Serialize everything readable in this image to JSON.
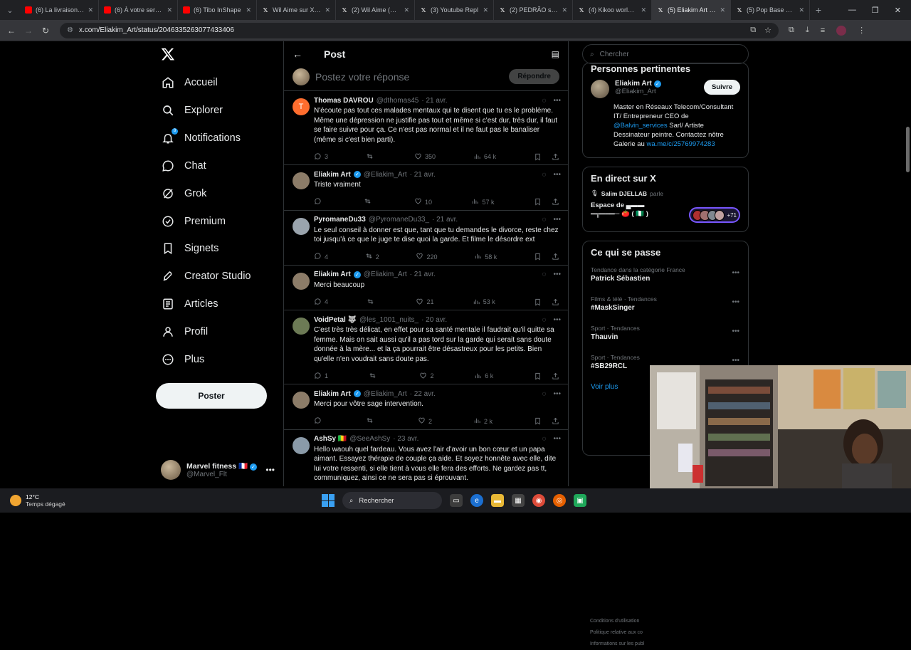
{
  "browser": {
    "tabs": [
      {
        "title": "(6) La livraison à d",
        "icon": "youtube-icon"
      },
      {
        "title": "(6) À votre service",
        "icon": "youtube-icon"
      },
      {
        "title": "(6) Tibo InShape",
        "icon": "youtube-icon"
      },
      {
        "title": "Wil Aime sur X : \"",
        "icon": "x-icon"
      },
      {
        "title": "(2) Wil Aime (@W",
        "icon": "x-icon"
      },
      {
        "title": "(3) Youtube Repl",
        "icon": "x-icon"
      },
      {
        "title": "(2) PEDRÃO sur X",
        "icon": "x-icon"
      },
      {
        "title": "(4) Kikoo world su",
        "icon": "x-icon"
      },
      {
        "title": "(5) Eliakim Art sur",
        "icon": "x-icon",
        "active": true
      },
      {
        "title": "(5) Pop Base sur X",
        "icon": "x-icon"
      }
    ],
    "url": "x.com/Eliakim_Art/status/2046335263077433406"
  },
  "nav": {
    "items": [
      {
        "label": "Accueil",
        "icon": "home-icon"
      },
      {
        "label": "Explorer",
        "icon": "search-icon"
      },
      {
        "label": "Notifications",
        "icon": "bell-icon"
      },
      {
        "label": "Chat",
        "icon": "chat-icon"
      },
      {
        "label": "Grok",
        "icon": "grok-icon"
      },
      {
        "label": "Premium",
        "icon": "premium-icon"
      },
      {
        "label": "Signets",
        "icon": "bookmark-icon"
      },
      {
        "label": "Creator Studio",
        "icon": "rocket-icon"
      },
      {
        "label": "Articles",
        "icon": "article-icon"
      },
      {
        "label": "Profil",
        "icon": "user-icon"
      },
      {
        "label": "Plus",
        "icon": "more-icon"
      }
    ],
    "post_label": "Poster",
    "account": {
      "name": "Marvel fitness 🇫🇷",
      "handle": "@Marvel_Flt"
    }
  },
  "main": {
    "title": "Post",
    "reply_placeholder": "Postez votre réponse",
    "reply_button": "Répondre",
    "tweets": [
      {
        "name": "Thomas DAVROU",
        "handle": "@dthomas45",
        "date": "· 21 avr.",
        "verified": false,
        "avatar_color": "#ff6d2e",
        "avatar_letter": "T",
        "text": "N'écoute pas tout ces malades mentaux qui te disent que tu es le problème. Même une dépression ne justifie pas tout et même si c'est dur, très dur, il faut se faire suivre pour ça. Ce n'est pas normal et il ne faut pas le banaliser (même si c'est bien parti).",
        "replies": "3",
        "reposts": "",
        "likes": "350",
        "views": "64 k"
      },
      {
        "name": "Eliakim Art",
        "handle": "@Eliakim_Art",
        "date": "· 21 avr.",
        "verified": true,
        "avatar_color": "#8c7c68",
        "text": "Triste vraiment",
        "replies": "",
        "reposts": "",
        "likes": "10",
        "views": "57 k"
      },
      {
        "name": "PyromaneDu33",
        "handle": "@PyromaneDu33_",
        "date": "· 21 avr.",
        "verified": false,
        "avatar_color": "#9aa4ad",
        "text": "Le seul conseil à donner est que, tant que tu demandes le divorce, reste chez toi jusqu'à ce que le juge te dise quoi la garde. Et filme le désordre ext",
        "replies": "4",
        "reposts": "2",
        "likes": "220",
        "views": "58 k"
      },
      {
        "name": "Eliakim Art",
        "handle": "@Eliakim_Art",
        "date": "· 21 avr.",
        "verified": true,
        "avatar_color": "#8c7c68",
        "text": "Merci beaucoup",
        "replies": "4",
        "reposts": "",
        "likes": "21",
        "views": "53 k"
      },
      {
        "name": "VoidPetal 🐺",
        "handle": "@les_1001_nuits_",
        "date": "· 20 avr.",
        "verified": false,
        "avatar_color": "#6c7a55",
        "text": "C'est très très délicat, en effet pour sa santé mentale il faudrait qu'il quitte sa femme. Mais on sait aussi qu'il a pas tord sur la garde qui serait sans doute donnée à la mère... et la ça pourrait être désastreux pour les petits. Bien qu'elle n'en voudrait sans doute pas.",
        "replies": "1",
        "reposts": "",
        "likes": "2",
        "views": "6 k"
      },
      {
        "name": "Eliakim Art",
        "handle": "@Eliakim_Art",
        "date": "· 22 avr.",
        "verified": true,
        "avatar_color": "#8c7c68",
        "text": "Merci pour vôtre sage intervention.",
        "replies": "",
        "reposts": "",
        "likes": "2",
        "views": "2 k"
      },
      {
        "name": "AshSy 🇲🇱",
        "handle": "@SeeAshSy",
        "date": "· 23 avr.",
        "verified": false,
        "avatar_color": "#8a9aa8",
        "text": "Hello waouh quel fardeau. Vous avez l'air d'avoir un bon cœur et un papa aimant. Essayez  thérapie de couple ça aide. Et soyez honnête avec elle, dite lui votre ressenti, si elle tient à vous elle fera des efforts. Ne gardez pas tt, communiquez, ainsi ce ne sera pas si éprouvant.",
        "replies": "",
        "reposts": "",
        "likes": "",
        "views": ""
      }
    ]
  },
  "sidebar": {
    "search_placeholder": "Chercher",
    "people_title": "Personnes pertinentes",
    "person": {
      "name": "Eliakim Art",
      "handle": "@Eliakim_Art",
      "follow": "Suivre",
      "bio_1": "Master en Réseaux Telecom/Consultant IT/ Entrepreneur CEO de ",
      "bio_link": "@Balvin_services",
      "bio_2": " Sarl/ Artiste Dessinateur peintre. Contactez nôtre Galerie au ",
      "bio_link2": "wa.me/c/25769974283"
    },
    "live_title": "En direct sur X",
    "live_host": "Salim DJELLAB",
    "live_host_action": "parle",
    "live_space": "Espace de ▄▬▬ ═╦═══─ 🍅 ( 🇳🇬 )",
    "live_count": "+71",
    "trends_title": "Ce qui se passe",
    "trends": [
      {
        "context": "Tendance dans la catégorie France",
        "topic": "Patrick Sébastien"
      },
      {
        "context": "Films & télé · Tendances",
        "topic": "#MaskSinger"
      },
      {
        "context": "Sport · Tendances",
        "topic": "Thauvin"
      },
      {
        "context": "Sport · Tendances",
        "topic": "#SB29RCL"
      }
    ],
    "see_more": "Voir plus",
    "footer": [
      "Conditions d'utilisation",
      "Politique relative aux co",
      "Informations sur les publ"
    ]
  },
  "taskbar": {
    "temp": "12°C",
    "weather": "Temps dégagé",
    "search": "Rechercher"
  }
}
